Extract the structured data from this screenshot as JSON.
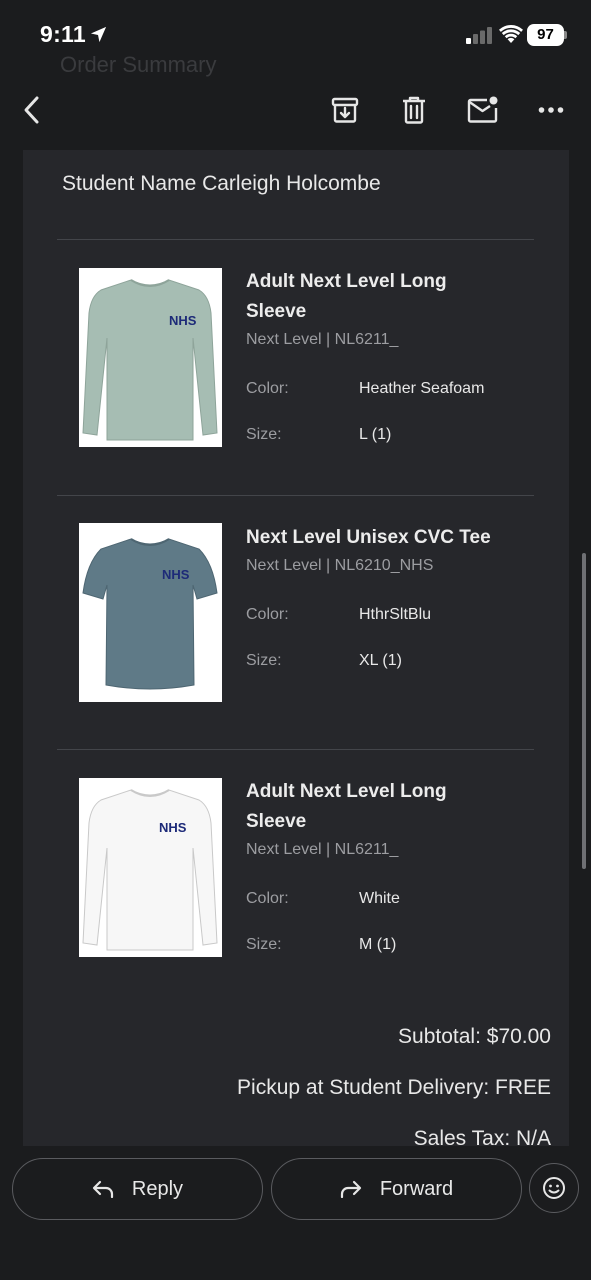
{
  "status": {
    "time": "9:11",
    "battery": "97"
  },
  "header": {
    "ghost_title": "Order Summary"
  },
  "email": {
    "student_name": "Student Name Carleigh Holcombe",
    "color_label": "Color:",
    "size_label": "Size:",
    "products": [
      {
        "name": "Adult Next Level Long Sleeve",
        "sku": "Next Level | NL6211_",
        "color": "Heather Seafoam",
        "size": "L (1)",
        "shirt_color": "#a6bdb3",
        "print": "NHS"
      },
      {
        "name": "Next Level Unisex CVC Tee",
        "sku": "Next Level | NL6210_NHS",
        "color": "HthrSltBlu",
        "size": "XL (1)",
        "shirt_color": "#5f7a87",
        "print": "NHS"
      },
      {
        "name": "Adult Next Level Long Sleeve",
        "sku": "Next Level | NL6211_",
        "color": "White",
        "size": "M (1)",
        "shirt_color": "#f7f7f7",
        "print": "NHS"
      }
    ],
    "totals": {
      "subtotal": "Subtotal: $70.00",
      "pickup": "Pickup at Student Delivery: FREE",
      "tax": "Sales Tax: N/A"
    }
  },
  "actions": {
    "reply": "Reply",
    "forward": "Forward"
  },
  "icons": [
    "location-arrow-icon",
    "cellular-signal-icon",
    "wifi-icon",
    "back-chevron-icon",
    "archive-icon",
    "trash-icon",
    "mark-unread-icon",
    "more-icon",
    "reply-icon",
    "forward-icon",
    "emoji-icon"
  ],
  "colors": {
    "background": "#1b1c1e",
    "card": "#26272b",
    "print_ink": "#1d2a78"
  }
}
